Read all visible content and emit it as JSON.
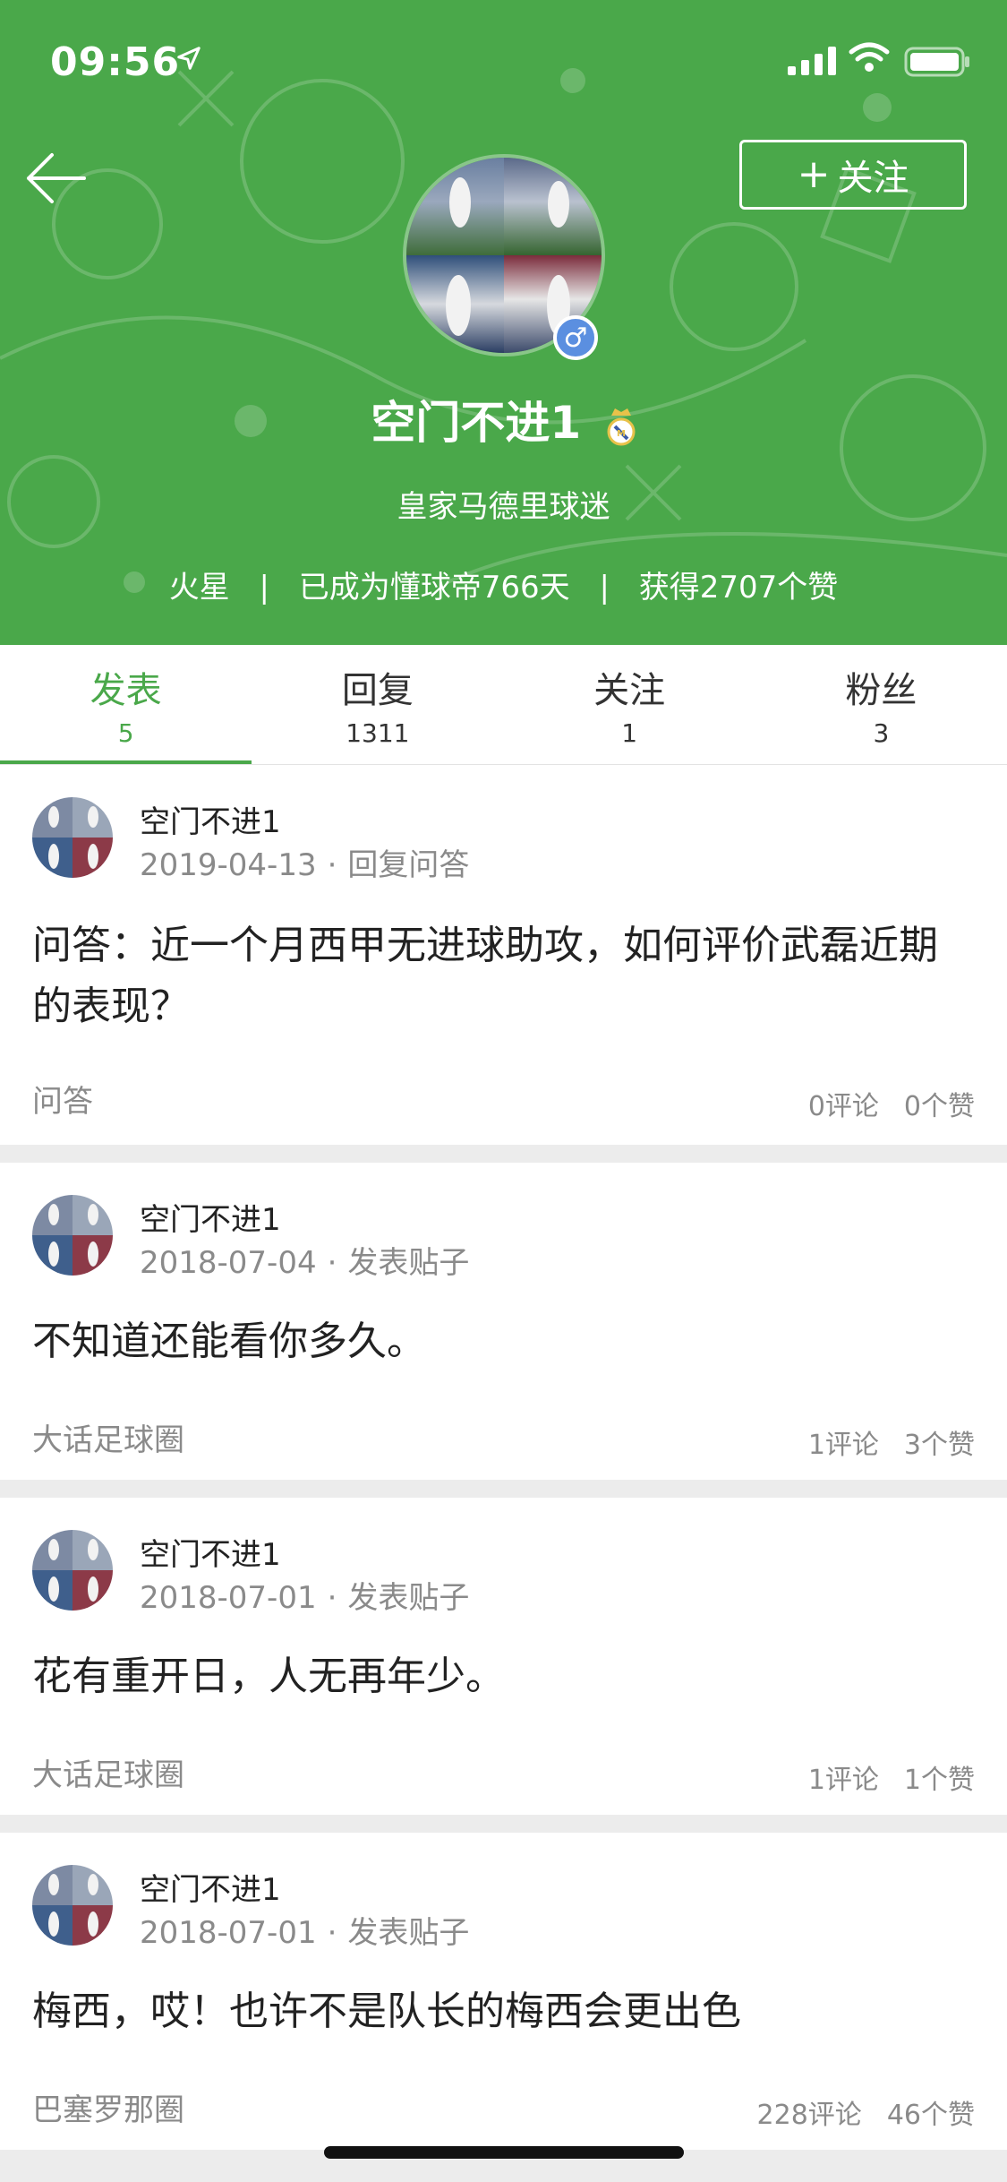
{
  "status_bar": {
    "time": "09:56"
  },
  "header": {
    "follow_label": "关注",
    "username": "空门不进1",
    "team_fan": "皇家马德里球迷",
    "location": "火星",
    "member_days": "已成为懂球帝766天",
    "likes_received": "获得2707个赞",
    "separator": "|",
    "accent_color": "#4aa84a"
  },
  "tabs": [
    {
      "label": "发表",
      "count": "5",
      "active": true
    },
    {
      "label": "回复",
      "count": "1311",
      "active": false
    },
    {
      "label": "关注",
      "count": "1",
      "active": false
    },
    {
      "label": "粉丝",
      "count": "3",
      "active": false
    }
  ],
  "posts": [
    {
      "author": "空门不进1",
      "date": "2019-04-13",
      "type": "回复问答",
      "body": "问答：近一个月西甲无进球助攻，如何评价武磊近期的表现？",
      "circle": "问答",
      "comments": "0评论",
      "likes": "0个赞"
    },
    {
      "author": "空门不进1",
      "date": "2018-07-04",
      "type": "发表贴子",
      "body": "不知道还能看你多久。",
      "circle": "大话足球圈",
      "comments": "1评论",
      "likes": "3个赞"
    },
    {
      "author": "空门不进1",
      "date": "2018-07-01",
      "type": "发表贴子",
      "body": "花有重开日，人无再年少。",
      "circle": "大话足球圈",
      "comments": "1评论",
      "likes": "1个赞"
    },
    {
      "author": "空门不进1",
      "date": "2018-07-01",
      "type": "发表贴子",
      "body": "梅西，哎！也许不是队长的梅西会更出色",
      "circle": "巴塞罗那圈",
      "comments": "228评论",
      "likes": "46个赞"
    }
  ],
  "meta_dot": "·",
  "icons": {
    "back": "arrow-left-icon",
    "navigation": "location-arrow-icon",
    "signal": "cellular-signal-icon",
    "wifi": "wifi-icon",
    "battery": "battery-icon",
    "gender": "male-icon",
    "crest": "real-madrid-crest-icon"
  }
}
